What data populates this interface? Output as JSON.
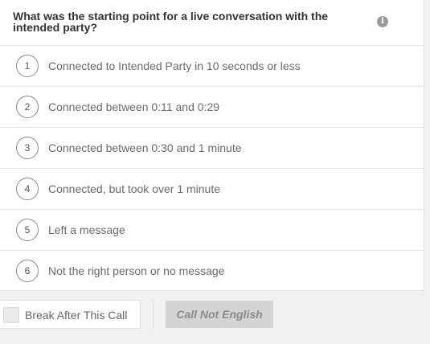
{
  "question": {
    "text": "What was the starting point for a live conversation with the intended party?",
    "info_icon_glyph": "i",
    "icon": "info-icon"
  },
  "options": [
    {
      "number": "1",
      "label": "Connected to Intended Party in 10 seconds or less"
    },
    {
      "number": "2",
      "label": "Connected between 0:11 and 0:29"
    },
    {
      "number": "3",
      "label": "Connected between 0:30 and 1 minute"
    },
    {
      "number": "4",
      "label": "Connected, but took over 1 minute"
    },
    {
      "number": "5",
      "label": "Left a message"
    },
    {
      "number": "6",
      "label": "Not the right person or no message"
    }
  ],
  "footer": {
    "break_label": "Break After This Call",
    "break_checked": false,
    "not_english_label": "Call Not English"
  },
  "colors": {
    "background": "#f1f1f1",
    "panel": "#ffffff",
    "button_disabled": "#d4d4d4"
  }
}
